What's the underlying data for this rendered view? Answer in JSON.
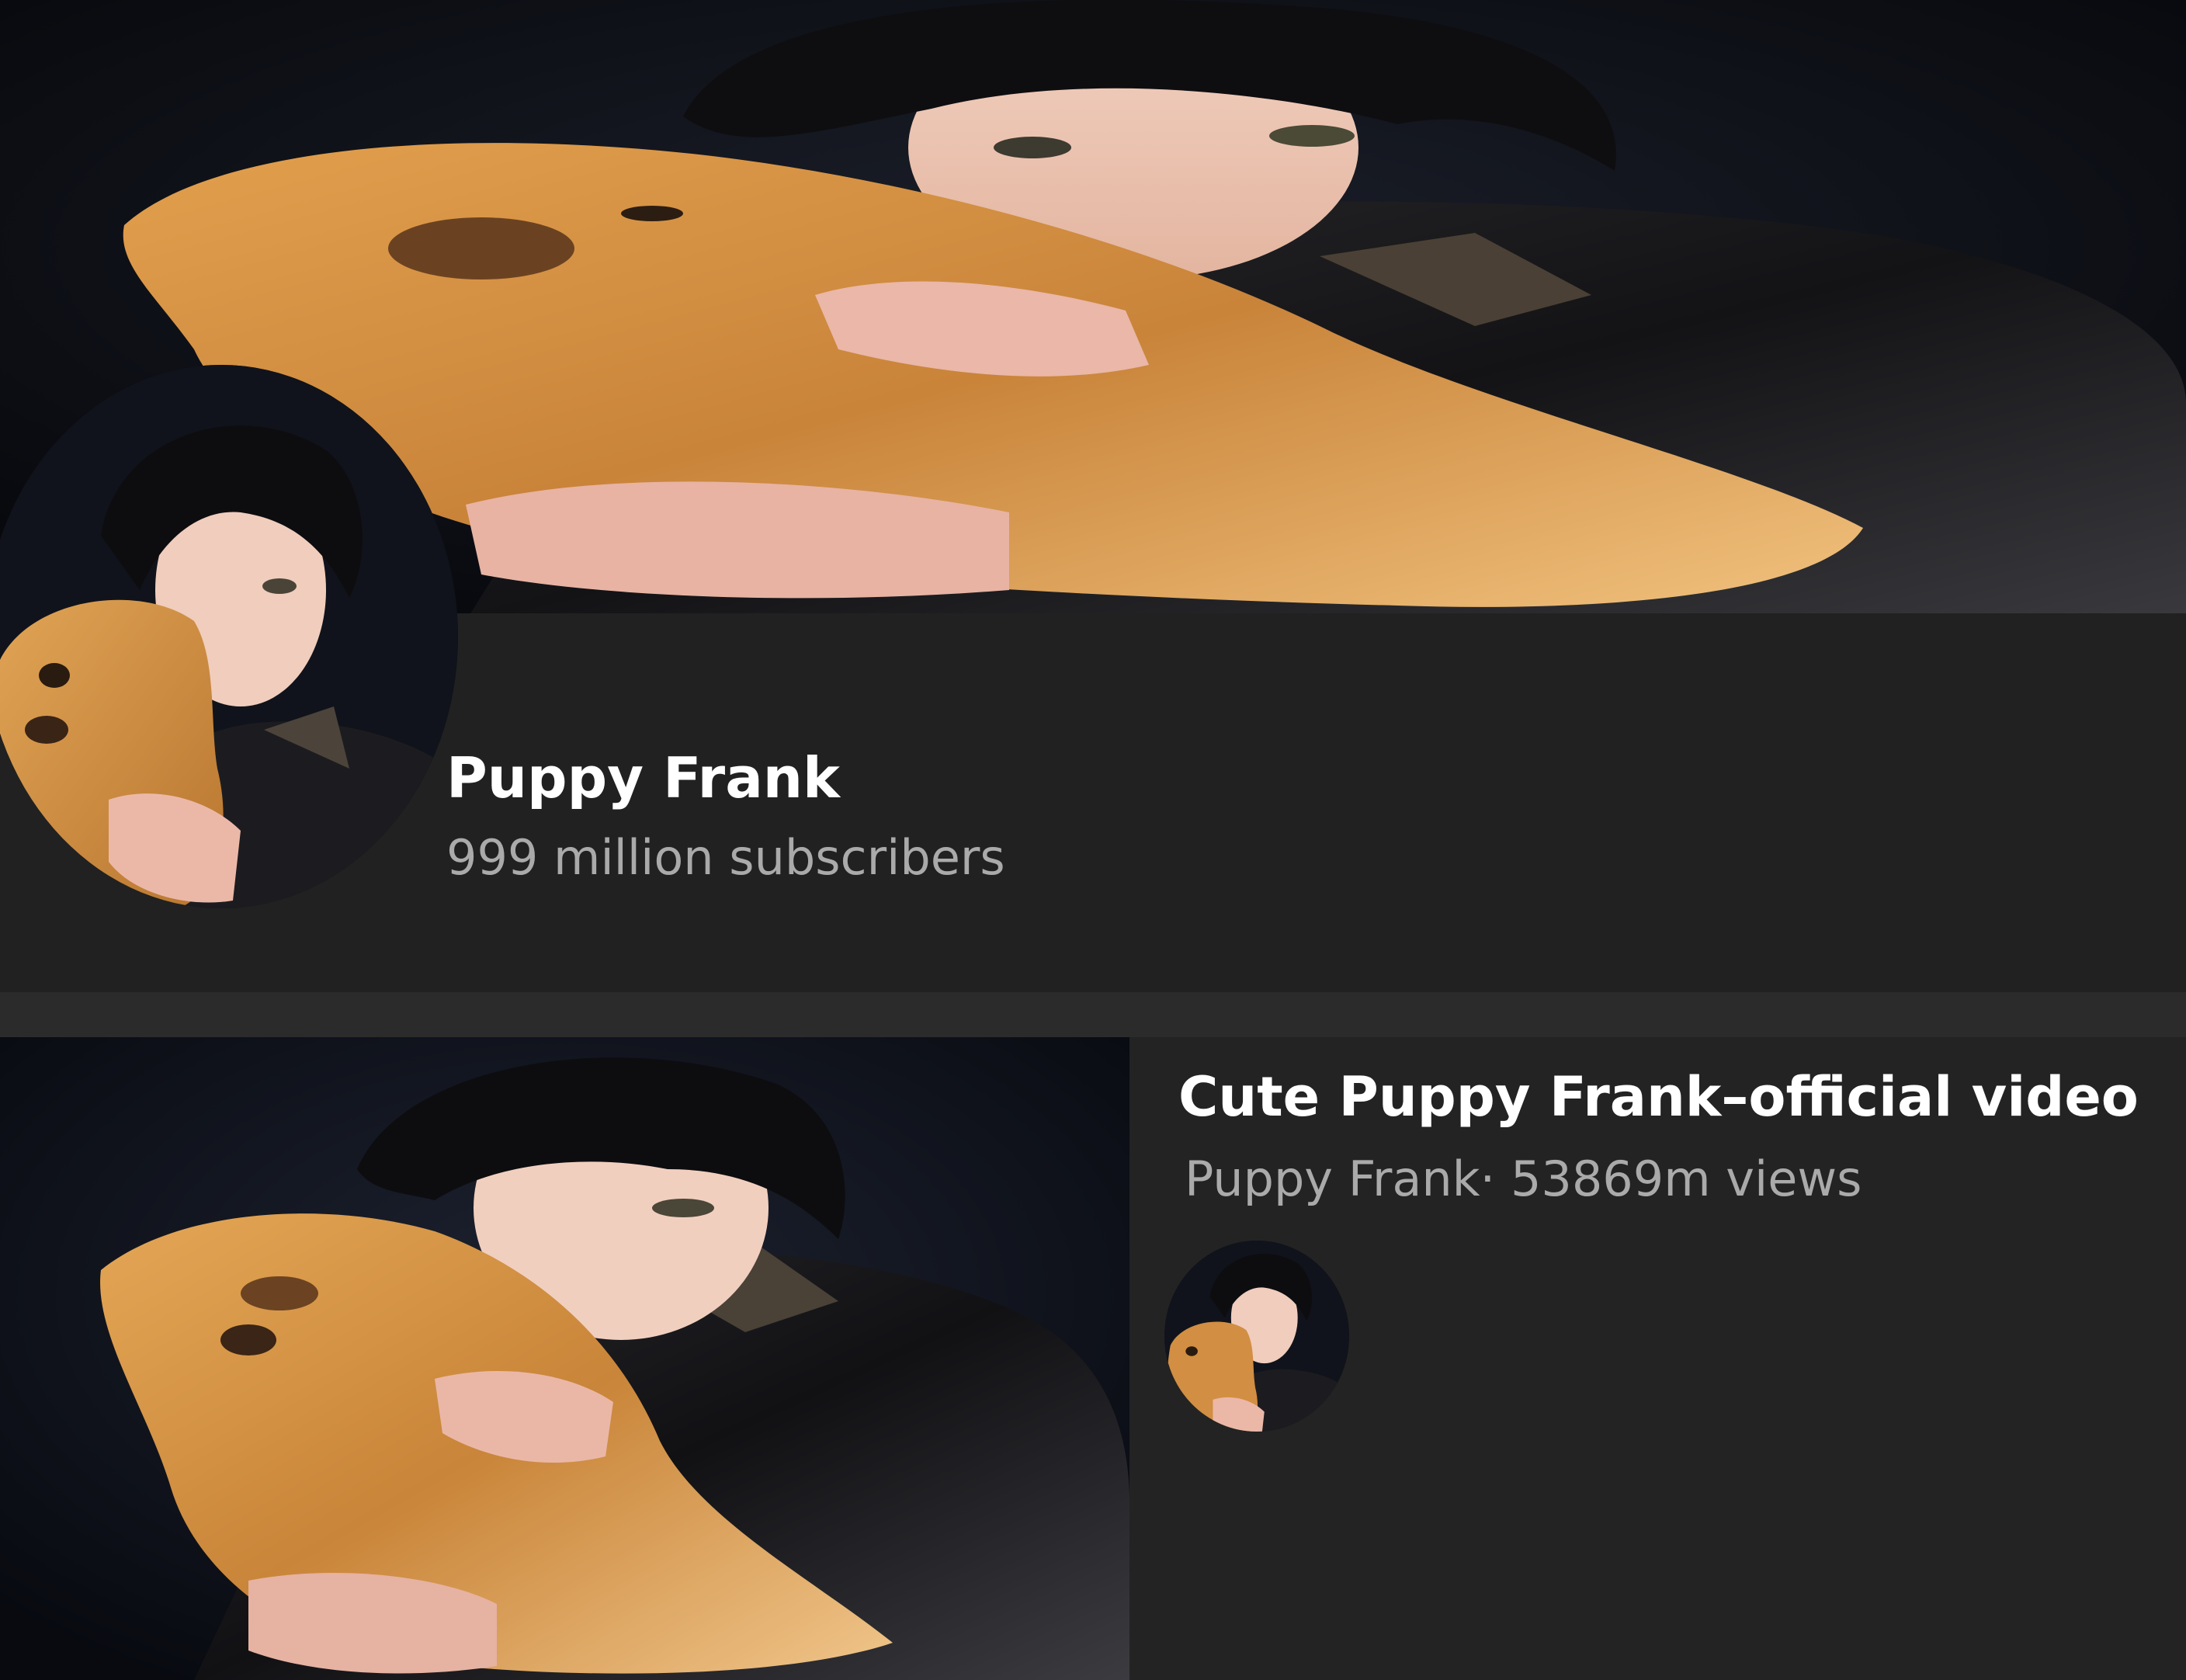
{
  "channel": {
    "name": "Puppy Frank",
    "subscribers": "999 million subscribers"
  },
  "video": {
    "title": "Cute Puppy Frank–official video",
    "channel_name": "Puppy Frank·",
    "views": "53869m views"
  },
  "colors": {
    "background": "#212121",
    "card_background": "#232323",
    "title_text": "#ffffff",
    "secondary_text": "#aaaaaa"
  },
  "icons": {
    "channel_avatar": "channel-avatar-photo",
    "video_avatar": "channel-avatar-photo"
  }
}
